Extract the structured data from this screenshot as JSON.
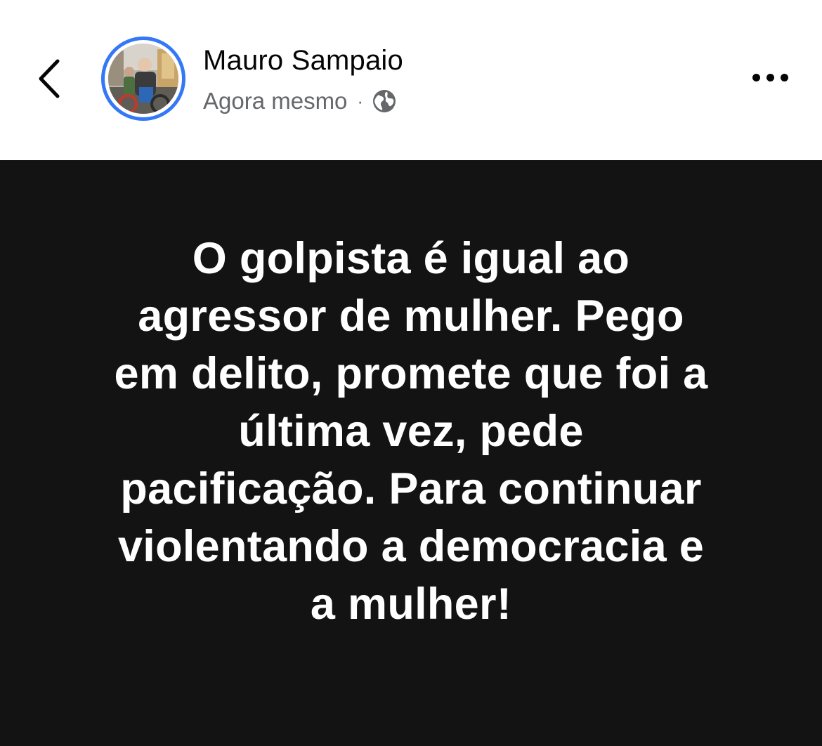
{
  "header": {
    "back_icon": "chevron-left-icon",
    "author_name": "Mauro Sampaio",
    "timestamp": "Agora mesmo",
    "separator": "·",
    "audience_icon": "globe-icon",
    "more_icon": "ellipsis-icon",
    "avatar_ring_color": "#3478f6"
  },
  "post": {
    "background_color": "#131313",
    "text_color": "#ffffff",
    "lines": [
      "O golpista é igual ao",
      "agressor de mulher. Pego",
      "em delito, promete que foi a",
      "última vez, pede",
      "pacificação. Para continuar",
      "violentando a democracia e",
      "a mulher!"
    ]
  }
}
